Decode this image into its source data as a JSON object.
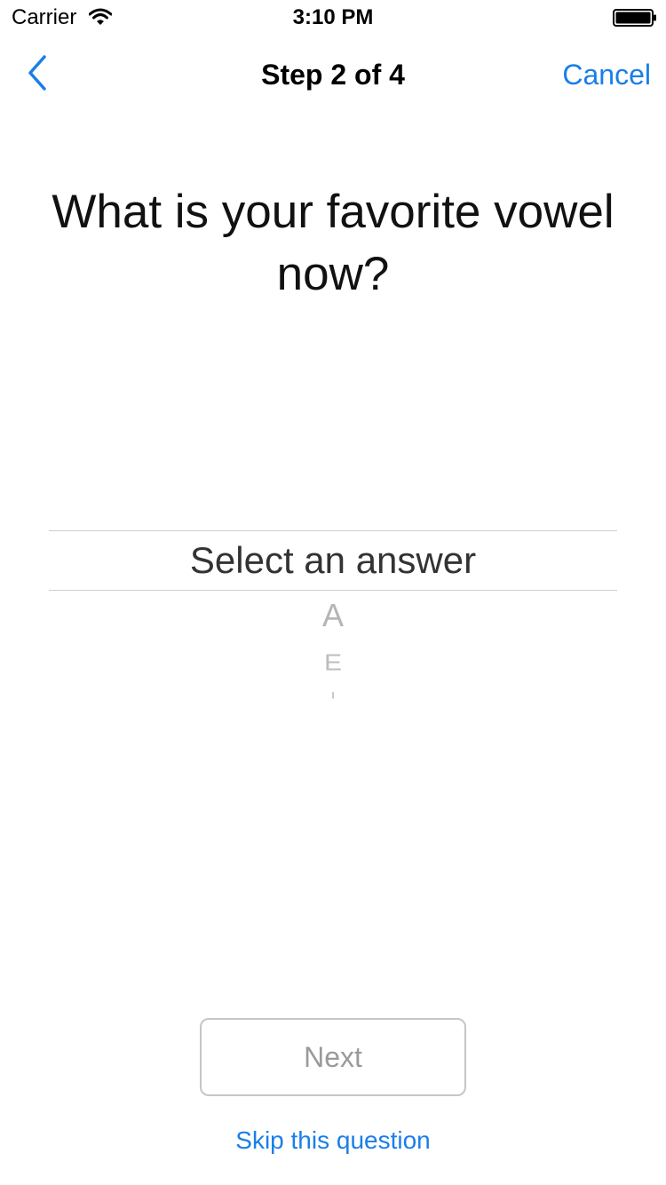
{
  "status_bar": {
    "carrier": "Carrier",
    "time": "3:10 PM",
    "wifi_icon": "wifi-icon",
    "battery_icon": "battery-icon"
  },
  "nav": {
    "back_icon": "chevron-left-icon",
    "title": "Step 2 of 4",
    "cancel_label": "Cancel"
  },
  "question": {
    "text": "What is your favorite vowel now?"
  },
  "picker": {
    "selected_label": "Select an answer",
    "options": [
      "A",
      "E",
      "I"
    ]
  },
  "actions": {
    "next_label": "Next",
    "skip_label": "Skip this question"
  },
  "colors": {
    "accent": "#1a7ee8",
    "disabled_text": "#9a9a9a",
    "picker_faded": "#b5b5b5"
  }
}
